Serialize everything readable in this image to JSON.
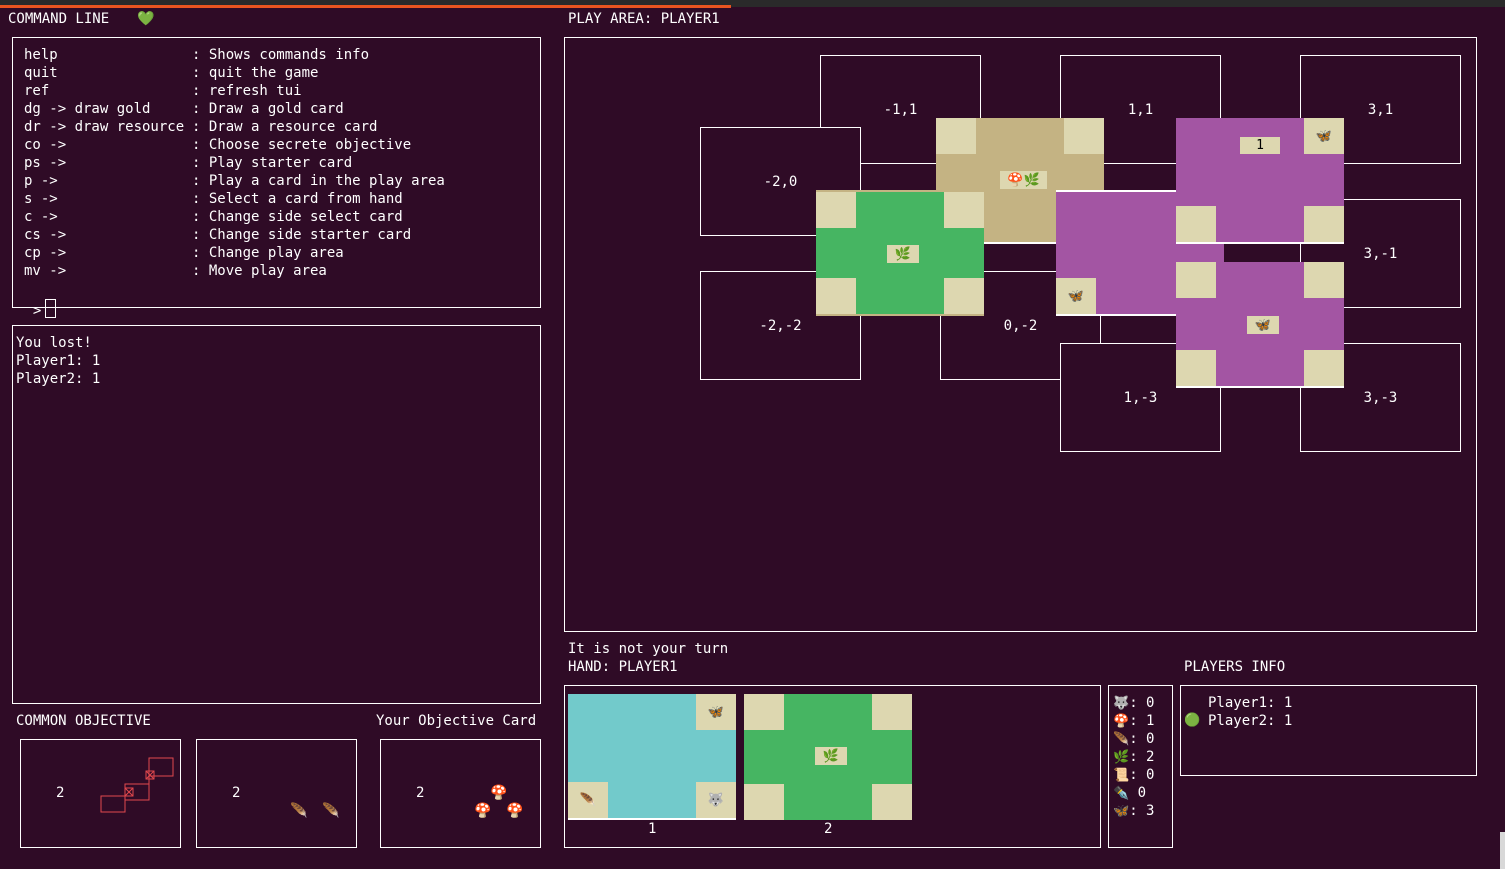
{
  "command_line": {
    "title": "COMMAND LINE",
    "heart": "💚",
    "commands": [
      {
        "cmd": "help",
        "desc": ": Shows commands info"
      },
      {
        "cmd": "quit",
        "desc": ": quit the game"
      },
      {
        "cmd": "ref",
        "desc": ": refresh tui"
      },
      {
        "cmd": "dg -> draw gold",
        "desc": ": Draw a gold card"
      },
      {
        "cmd": "dr -> draw resource",
        "desc": ": Draw a resource card"
      },
      {
        "cmd": "co ->",
        "desc": ": Choose secrete objective"
      },
      {
        "cmd": "ps ->",
        "desc": ": Play starter card"
      },
      {
        "cmd": "p ->",
        "desc": ": Play a card in the play area"
      },
      {
        "cmd": "s ->",
        "desc": ": Select a card from hand"
      },
      {
        "cmd": "c ->",
        "desc": ": Change side select card"
      },
      {
        "cmd": "cs ->",
        "desc": ": Change side starter card"
      },
      {
        "cmd": "cp ->",
        "desc": ": Change play area"
      },
      {
        "cmd": "mv ->",
        "desc": ": Move play area"
      }
    ],
    "prompt": ">"
  },
  "messages": [
    "You lost!",
    "Player1: 1",
    "Player2: 1"
  ],
  "objectives": {
    "common_title": "COMMON OBJECTIVE",
    "your_title": "Your Objective Card",
    "cards": [
      {
        "points": "2",
        "pattern": "diagonal-red"
      },
      {
        "points": "2",
        "icons": [
          "🪶",
          "🪶"
        ]
      },
      {
        "points": "2",
        "icons": [
          "🍄",
          "🍄",
          "🍄"
        ]
      }
    ]
  },
  "play_area": {
    "title": "PLAY AREA: PLAYER1",
    "cells": [
      "-1,1",
      "1,1",
      "3,1",
      "-2,0",
      "3,-1",
      "-2,-2",
      "0,-2",
      "1,-3",
      "3,-3"
    ],
    "cards": [
      {
        "color": "#c4b383",
        "center": "🍄🌿"
      },
      {
        "color": "#46b562",
        "center": "🌿"
      },
      {
        "color": "#a355a3",
        "corner": "🦋"
      },
      {
        "color": "#a355a3",
        "label": "1",
        "corner": "🦋"
      },
      {
        "color": "#a355a3",
        "center": "🦋"
      }
    ]
  },
  "status": {
    "turn": "It is not your turn",
    "hand_title": "HAND: PLAYER1"
  },
  "hand": [
    {
      "index": "1",
      "color": "#72cacb",
      "corners": [
        "🦋",
        "🪶",
        "🐺"
      ]
    },
    {
      "index": "2",
      "color": "#46b562",
      "center": "🌿"
    }
  ],
  "resources": [
    {
      "icon": "🐺",
      "value": ": 0"
    },
    {
      "icon": "🍄",
      "value": ": 1"
    },
    {
      "icon": "🪶",
      "value": ": 0"
    },
    {
      "icon": "🌿",
      "value": ": 2"
    },
    {
      "icon": "📜",
      "value": ": 0"
    },
    {
      "icon": "✒️",
      "value": " 0"
    },
    {
      "icon": "🦋",
      "value": ": 3"
    }
  ],
  "players_info": {
    "title": "PLAYERS INFO",
    "players": [
      {
        "name": "Player1: 1",
        "marker": ""
      },
      {
        "name": "Player2: 1",
        "marker": "🟢"
      }
    ]
  },
  "colors": {
    "background": "#2f0b26",
    "gold": "#c4b383",
    "green": "#46b562",
    "purple": "#a355a3",
    "blue": "#72cacb",
    "corner": "#ddd7b0",
    "accent": "#e95420"
  }
}
